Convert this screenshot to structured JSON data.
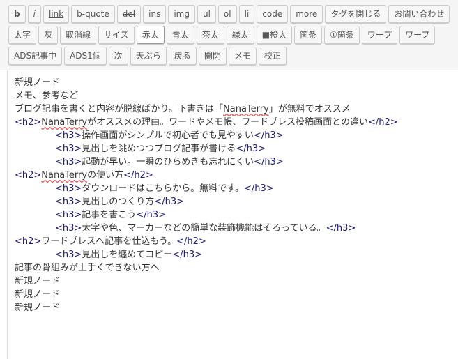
{
  "toolbar": {
    "row1": [
      {
        "id": "b",
        "label": "b"
      },
      {
        "id": "i",
        "label": "i"
      },
      {
        "id": "link",
        "label": "link"
      },
      {
        "id": "b-quote",
        "label": "b-quote"
      },
      {
        "id": "del",
        "label": "del"
      },
      {
        "id": "ins",
        "label": "ins"
      },
      {
        "id": "img",
        "label": "img"
      },
      {
        "id": "ul",
        "label": "ul"
      },
      {
        "id": "ol",
        "label": "ol"
      },
      {
        "id": "li",
        "label": "li"
      },
      {
        "id": "code",
        "label": "code"
      },
      {
        "id": "more",
        "label": "more"
      },
      {
        "id": "close-tags",
        "label": "タグを閉じる"
      },
      {
        "id": "contact",
        "label": "お問い合わせ"
      }
    ],
    "row2": [
      {
        "id": "bold-jp",
        "label": "太字"
      },
      {
        "id": "gray",
        "label": "灰"
      },
      {
        "id": "strike",
        "label": "取消線"
      },
      {
        "id": "size",
        "label": "サイズ"
      },
      {
        "id": "red-bold",
        "label": "赤太"
      },
      {
        "id": "blue-bold",
        "label": "青太"
      },
      {
        "id": "brown-bold",
        "label": "茶太"
      },
      {
        "id": "green-bold",
        "label": "緑太"
      },
      {
        "id": "orange-bold",
        "label": "■橙太"
      },
      {
        "id": "bullet",
        "label": "箇条"
      },
      {
        "id": "numbered",
        "label": "①箇条"
      },
      {
        "id": "warp",
        "label": "ワープ"
      },
      {
        "id": "warp2",
        "label": "ワープ"
      }
    ],
    "row3": [
      {
        "id": "ads-article",
        "label": "ADS記事中"
      },
      {
        "id": "ads1",
        "label": "ADS1個"
      },
      {
        "id": "next",
        "label": "次"
      },
      {
        "id": "tempura",
        "label": "天ぷら"
      },
      {
        "id": "back",
        "label": "戻る"
      },
      {
        "id": "open-close",
        "label": "開閉"
      },
      {
        "id": "memo",
        "label": "メモ"
      },
      {
        "id": "proof",
        "label": "校正"
      }
    ]
  },
  "editor": {
    "lines": [
      {
        "id": "l1",
        "indent": false,
        "parts": [
          {
            "t": "新規ノード"
          }
        ]
      },
      {
        "id": "l2",
        "indent": false,
        "parts": [
          {
            "t": "メモ、参考など"
          }
        ]
      },
      {
        "id": "l3",
        "indent": false,
        "parts": [
          {
            "t": "ブログ記事を書くと内容が脱線ばかり。下書きは「"
          },
          {
            "t": "NanaTerry",
            "sq": true
          },
          {
            "t": "」が無料でオススメ"
          }
        ]
      },
      {
        "id": "l4",
        "indent": false,
        "parts": [
          {
            "t": "<h2>",
            "tag": true
          },
          {
            "t": "NanaTerry",
            "sq": true
          },
          {
            "t": "がオススメの理由。ワードやメモ帳、ワードプレス投稿画面との違い"
          },
          {
            "t": "</h2>",
            "tag": true
          }
        ]
      },
      {
        "id": "l5",
        "indent": true,
        "parts": [
          {
            "t": "<h3>",
            "tag": true
          },
          {
            "t": "操作画面がシンプルで初心者でも見やすい"
          },
          {
            "t": "</h3>",
            "tag": true
          }
        ]
      },
      {
        "id": "l6",
        "indent": true,
        "parts": [
          {
            "t": "<h3>",
            "tag": true
          },
          {
            "t": "見出しを眺めつつブログ記事が書ける"
          },
          {
            "t": "</h3>",
            "tag": true
          }
        ]
      },
      {
        "id": "l7",
        "indent": true,
        "parts": [
          {
            "t": "<h3>",
            "tag": true
          },
          {
            "t": "起動が早い。一瞬のひらめきも忘れにくい"
          },
          {
            "t": "</h3>",
            "tag": true
          }
        ]
      },
      {
        "id": "l8",
        "indent": false,
        "parts": [
          {
            "t": "<h2>",
            "tag": true
          },
          {
            "t": "NanaTerry",
            "sq": true
          },
          {
            "t": "の使い方"
          },
          {
            "t": "</h2>",
            "tag": true
          }
        ]
      },
      {
        "id": "l9",
        "indent": true,
        "parts": [
          {
            "t": "<h3>",
            "tag": true
          },
          {
            "t": "ダウンロードはこちらから。無料です。"
          },
          {
            "t": "</h3>",
            "tag": true
          }
        ]
      },
      {
        "id": "l10",
        "indent": true,
        "parts": [
          {
            "t": "<h3>",
            "tag": true
          },
          {
            "t": "見出しのつくり方"
          },
          {
            "t": "</h3>",
            "tag": true
          }
        ]
      },
      {
        "id": "l11",
        "indent": true,
        "parts": [
          {
            "t": "<h3>",
            "tag": true
          },
          {
            "t": "記事を書こう"
          },
          {
            "t": "</h3>",
            "tag": true
          }
        ]
      },
      {
        "id": "l12",
        "indent": true,
        "parts": [
          {
            "t": "<h3>",
            "tag": true
          },
          {
            "t": "太字や色、マーカーなどの簡単な装飾機能はそろっている。"
          },
          {
            "t": "</h3>",
            "tag": true
          }
        ]
      },
      {
        "id": "l13",
        "indent": false,
        "parts": [
          {
            "t": "<h2>",
            "tag": true
          },
          {
            "t": "ワードプレスへ記事を仕込もう。"
          },
          {
            "t": "</h2>",
            "tag": true
          }
        ]
      },
      {
        "id": "l14",
        "indent": true,
        "parts": [
          {
            "t": "<h3>",
            "tag": true
          },
          {
            "t": "見出しを纏めてコピー"
          },
          {
            "t": "</h3>",
            "tag": true
          }
        ]
      },
      {
        "id": "l15",
        "indent": false,
        "parts": [
          {
            "t": "記事の骨組みが上手くできない方へ"
          }
        ]
      },
      {
        "id": "l16",
        "indent": false,
        "parts": [
          {
            "t": "新規ノード"
          }
        ]
      },
      {
        "id": "l17",
        "indent": false,
        "parts": [
          {
            "t": "新規ノード"
          }
        ]
      },
      {
        "id": "l18",
        "indent": false,
        "parts": [
          {
            "t": "新規ノード"
          }
        ]
      }
    ]
  },
  "colors": {
    "tag": "#1a1a7a",
    "text": "#333333",
    "squiggle": "#e05555"
  }
}
